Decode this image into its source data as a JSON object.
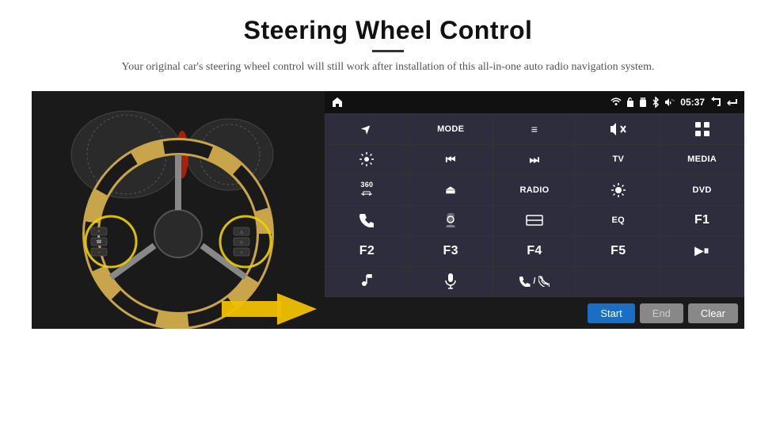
{
  "header": {
    "title": "Steering Wheel Control",
    "subtitle": "Your original car's steering wheel control will still work after installation of this all-in-one auto radio navigation system."
  },
  "status_bar": {
    "time": "05:37",
    "icons": [
      "wifi",
      "lock",
      "sd",
      "bluetooth",
      "volume",
      "back",
      "home"
    ]
  },
  "grid_buttons": [
    {
      "id": "btn-navigate",
      "type": "icon",
      "icon": "▲",
      "icon_rotated": true
    },
    {
      "id": "btn-mode",
      "type": "text",
      "label": "MODE"
    },
    {
      "id": "btn-list",
      "type": "icon",
      "icon": "≡"
    },
    {
      "id": "btn-mute",
      "type": "icon",
      "icon": "🔇"
    },
    {
      "id": "btn-apps",
      "type": "icon",
      "icon": "⊞"
    },
    {
      "id": "btn-settings",
      "type": "icon",
      "icon": "⚙"
    },
    {
      "id": "btn-prev",
      "type": "icon",
      "icon": "⏮"
    },
    {
      "id": "btn-next",
      "type": "icon",
      "icon": "⏭"
    },
    {
      "id": "btn-tv",
      "type": "text",
      "label": "TV"
    },
    {
      "id": "btn-media",
      "type": "text",
      "label": "MEDIA"
    },
    {
      "id": "btn-360",
      "type": "icon",
      "icon": "360"
    },
    {
      "id": "btn-eject",
      "type": "icon",
      "icon": "⏏"
    },
    {
      "id": "btn-radio",
      "type": "text",
      "label": "RADIO"
    },
    {
      "id": "btn-brightness",
      "type": "icon",
      "icon": "☀"
    },
    {
      "id": "btn-dvd",
      "type": "text",
      "label": "DVD"
    },
    {
      "id": "btn-phone",
      "type": "icon",
      "icon": "📞"
    },
    {
      "id": "btn-map",
      "type": "icon",
      "icon": "🗺"
    },
    {
      "id": "btn-window",
      "type": "icon",
      "icon": "▭"
    },
    {
      "id": "btn-eq",
      "type": "text",
      "label": "EQ"
    },
    {
      "id": "btn-f1",
      "type": "text",
      "label": "F1"
    },
    {
      "id": "btn-f2",
      "type": "text",
      "label": "F2"
    },
    {
      "id": "btn-f3",
      "type": "text",
      "label": "F3"
    },
    {
      "id": "btn-f4",
      "type": "text",
      "label": "F4"
    },
    {
      "id": "btn-f5",
      "type": "text",
      "label": "F5"
    },
    {
      "id": "btn-playpause",
      "type": "icon",
      "icon": "▶⏸"
    },
    {
      "id": "btn-music",
      "type": "icon",
      "icon": "♪"
    },
    {
      "id": "btn-mic",
      "type": "icon",
      "icon": "🎤"
    },
    {
      "id": "btn-call",
      "type": "icon",
      "icon": "📱"
    },
    {
      "id": "btn-empty1",
      "type": "empty",
      "label": ""
    },
    {
      "id": "btn-empty2",
      "type": "empty",
      "label": ""
    }
  ],
  "bottom_bar": {
    "start_label": "Start",
    "end_label": "End",
    "clear_label": "Clear"
  },
  "colors": {
    "panel_bg": "#1a1a2e",
    "btn_bg": "#2d2d3d",
    "status_bg": "#111",
    "bottom_bg": "#1a1a1a",
    "start_btn": "#1a6fc4",
    "end_btn": "#888888",
    "clear_btn": "#888888"
  }
}
